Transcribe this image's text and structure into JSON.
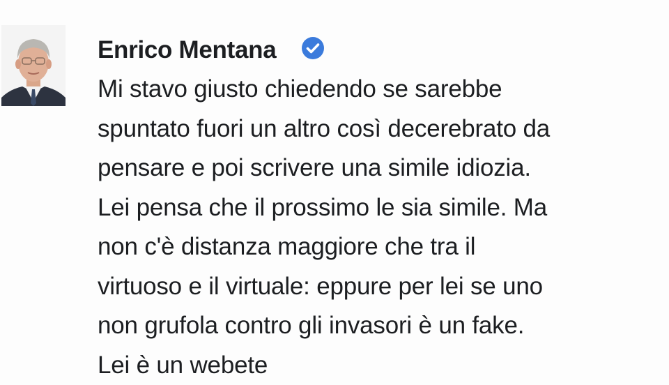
{
  "comment": {
    "author": "Enrico Mentana",
    "verified": true,
    "avatar_icon": "person-photo",
    "badge_color": "#3b7bdc",
    "text_lines": [
      "Mi stavo giusto chiedendo se sarebbe",
      "spuntato fuori un altro così decerebrato da",
      "pensare e poi scrivere una simile idiozia.",
      "Lei pensa che il prossimo le sia simile. Ma",
      "non c'è distanza maggiore che tra il",
      "virtuoso e il virtuale: eppure per lei se uno",
      "non grufola contro gli invasori è un fake.",
      "Lei è un webete"
    ]
  }
}
